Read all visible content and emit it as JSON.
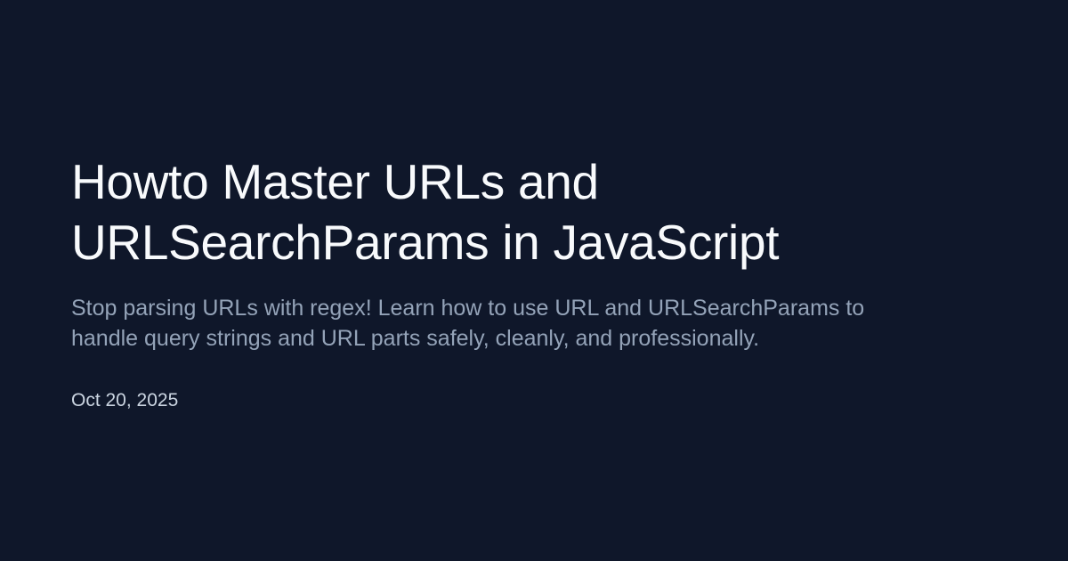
{
  "post": {
    "title_lines": [
      "Howto Master URLs and",
      "URLSearchParams in JavaScript"
    ],
    "description_lines": [
      "Stop parsing URLs with regex! Learn how to use URL and URLSearchParams to",
      "handle query strings and URL parts safely, cleanly, and professionally."
    ],
    "date": "Oct 20, 2025"
  },
  "colors": {
    "background": "#0f172a",
    "title": "#f8fafc",
    "description": "#94a3b8",
    "date": "#cbd5e1"
  }
}
